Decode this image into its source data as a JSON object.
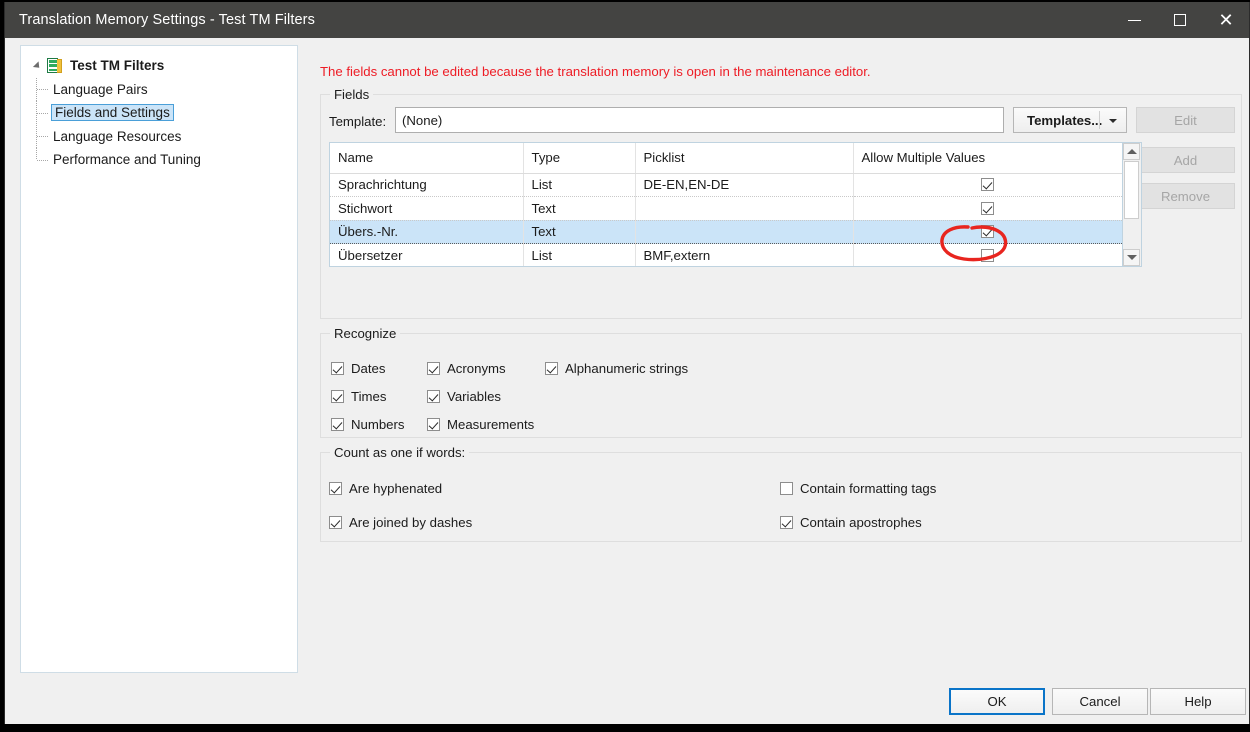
{
  "window": {
    "title": "Translation Memory Settings - Test TM Filters",
    "controls": {
      "minimize": "minimize-icon",
      "maximize": "maximize-icon",
      "close": "close-icon"
    }
  },
  "sidebar": {
    "root": {
      "label": "Test TM Filters",
      "icon": "translation-memory-icon"
    },
    "items": [
      {
        "label": "Language Pairs",
        "selected": false
      },
      {
        "label": "Fields and Settings",
        "selected": true
      },
      {
        "label": "Language Resources",
        "selected": false
      },
      {
        "label": "Performance and Tuning",
        "selected": false
      }
    ]
  },
  "main": {
    "warning": "The fields cannot be edited because the translation memory is open in the maintenance editor.",
    "warning_color": "#ee1c25",
    "fields_group": {
      "legend": "Fields",
      "template_label": "Template:",
      "template_value": "(None)",
      "templates_button": "Templates...",
      "side_buttons": [
        {
          "label": "Edit",
          "enabled": false
        },
        {
          "label": "Add",
          "enabled": false
        },
        {
          "label": "Remove",
          "enabled": false
        }
      ],
      "grid": {
        "columns": [
          "Name",
          "Type",
          "Picklist",
          "Allow Multiple Values"
        ],
        "rows": [
          {
            "name": "Sprachrichtung",
            "type": "List",
            "picklist": "DE-EN,EN-DE",
            "allow_multiple": true,
            "selected": false
          },
          {
            "name": "Stichwort",
            "type": "Text",
            "picklist": "",
            "allow_multiple": true,
            "selected": false
          },
          {
            "name": "Übers.-Nr.",
            "type": "Text",
            "picklist": "",
            "allow_multiple": true,
            "selected": true
          },
          {
            "name": "Übersetzer",
            "type": "List",
            "picklist": "BMF,extern",
            "allow_multiple": false,
            "selected": false
          }
        ]
      }
    },
    "recognize_group": {
      "legend": "Recognize",
      "options": [
        {
          "label": "Dates",
          "checked": true
        },
        {
          "label": "Times",
          "checked": true
        },
        {
          "label": "Numbers",
          "checked": true
        },
        {
          "label": "Acronyms",
          "checked": true
        },
        {
          "label": "Variables",
          "checked": true
        },
        {
          "label": "Measurements",
          "checked": true
        },
        {
          "label": "Alphanumeric strings",
          "checked": true
        }
      ]
    },
    "count_group": {
      "legend": "Count as one if words:",
      "options": [
        {
          "label": "Are hyphenated",
          "checked": true
        },
        {
          "label": "Are joined by dashes",
          "checked": true
        },
        {
          "label": "Contain formatting tags",
          "checked": false
        },
        {
          "label": "Contain apostrophes",
          "checked": true
        }
      ]
    }
  },
  "footer": {
    "ok": "OK",
    "cancel": "Cancel",
    "help": "Help",
    "default_button": "OK",
    "focus_color": "#0a74c8"
  },
  "annotation": {
    "shape": "hand-drawn-ellipse",
    "color": "#e8251f",
    "target": "allow-multiple-values checkbox of row Übers.-Nr."
  }
}
